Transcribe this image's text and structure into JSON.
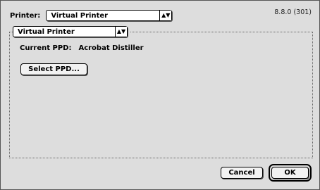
{
  "printer": {
    "label": "Printer:",
    "selected": "Virtual Printer"
  },
  "version": "8.8.0 (301)",
  "group": {
    "selected": "Virtual Printer",
    "current_ppd_label": "Current PPD:",
    "current_ppd_value": "Acrobat Distiller",
    "select_ppd_label": "Select PPD..."
  },
  "buttons": {
    "cancel": "Cancel",
    "ok": "OK"
  },
  "icons": {
    "popup_arrows": "up-down-arrows-icon"
  }
}
